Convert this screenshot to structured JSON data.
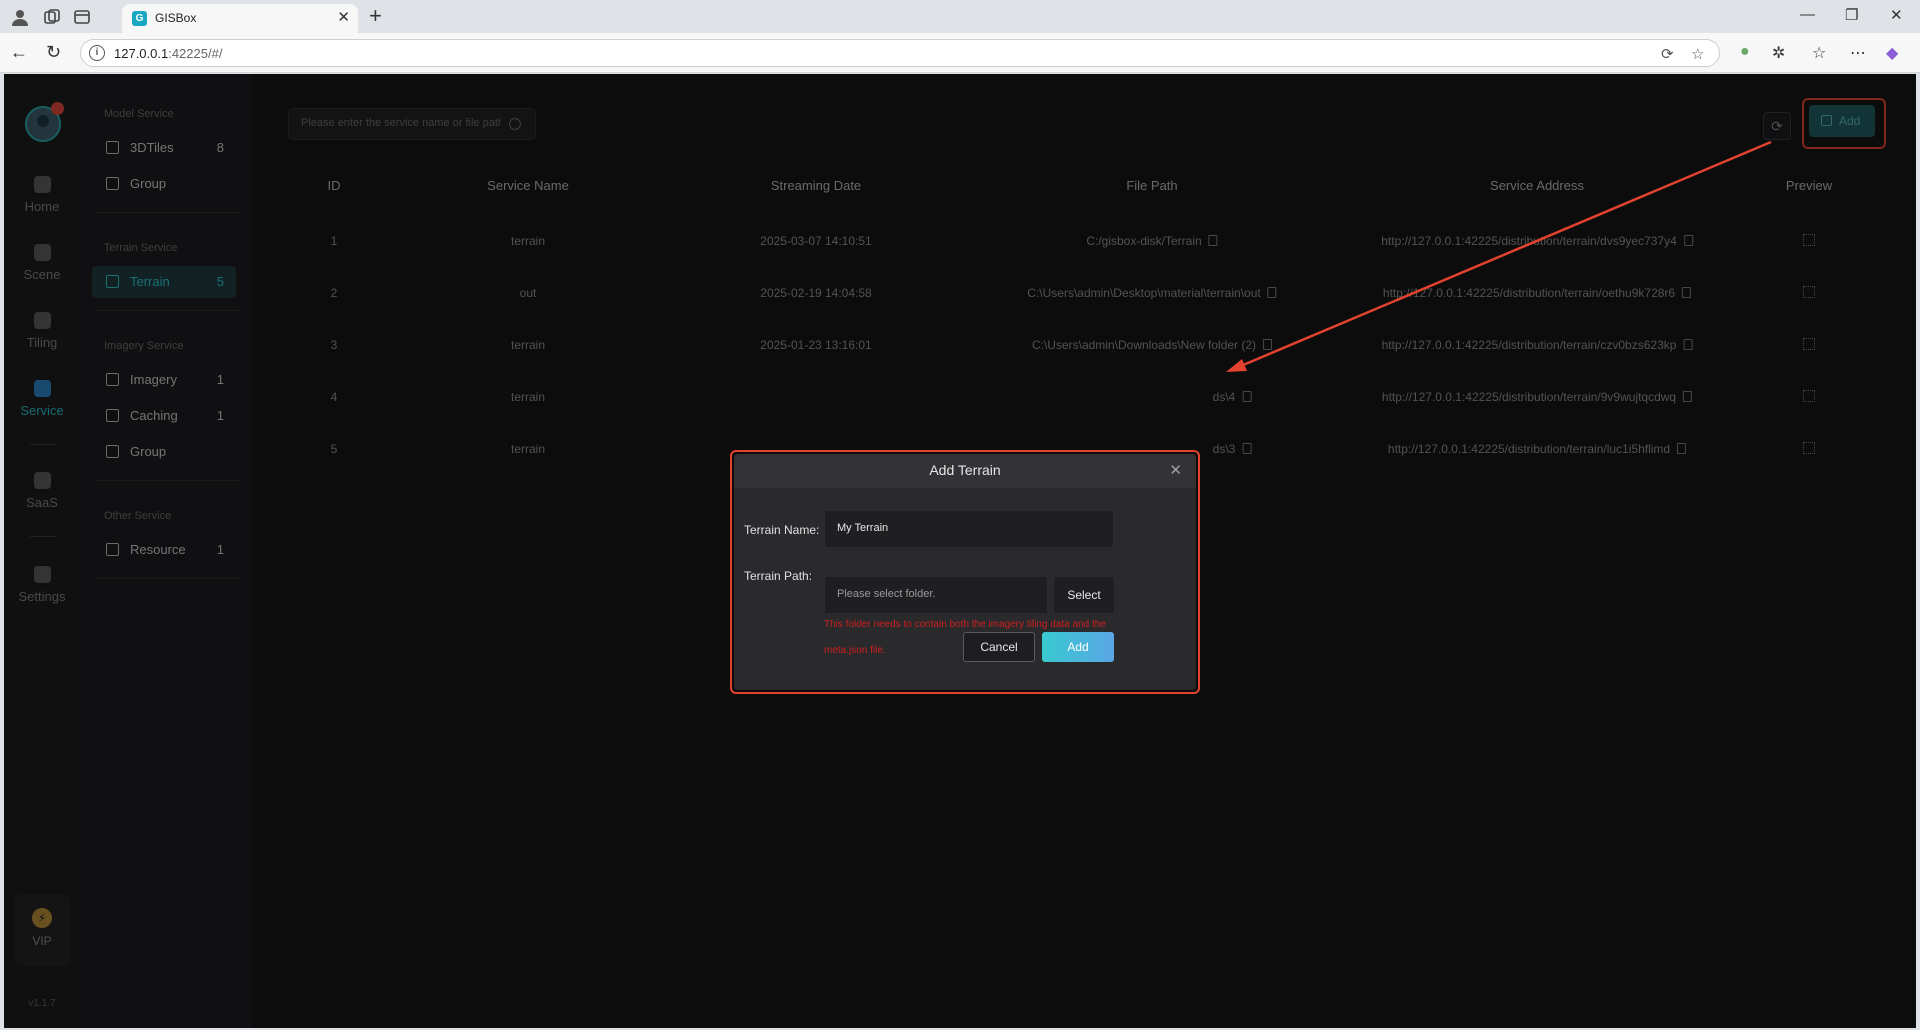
{
  "browser": {
    "tab_title": "GISBox",
    "tab_favicon": "G",
    "url_host": "127.0.0.1",
    "url_rest": ":42225/#/"
  },
  "rail": {
    "items": [
      {
        "label": "Home",
        "icon": "home-icon"
      },
      {
        "label": "Scene",
        "icon": "scene-icon"
      },
      {
        "label": "Tiling",
        "icon": "tiling-icon"
      },
      {
        "label": "Service",
        "icon": "service-icon"
      },
      {
        "label": "SaaS",
        "icon": "saas-icon"
      },
      {
        "label": "Settings",
        "icon": "settings-icon"
      }
    ],
    "vip_label": "VIP",
    "version": "v1.1.7"
  },
  "panel": {
    "model_title": "Model Service",
    "model_items": [
      {
        "label": "3DTiles",
        "count": "8"
      },
      {
        "label": "Group",
        "count": ""
      }
    ],
    "terrain_title": "Terrain Service",
    "terrain_items": [
      {
        "label": "Terrain",
        "count": "5"
      }
    ],
    "imagery_title": "Imagery Service",
    "imagery_items": [
      {
        "label": "Imagery",
        "count": "1"
      },
      {
        "label": "Caching",
        "count": "1"
      },
      {
        "label": "Group",
        "count": ""
      }
    ],
    "other_title": "Other Service",
    "other_items": [
      {
        "label": "Resource",
        "count": "1"
      }
    ]
  },
  "toolbar": {
    "search_placeholder": "Please enter the service name or file path.",
    "add_label": "Add"
  },
  "table": {
    "headers": [
      "ID",
      "Service Name",
      "Streaming Date",
      "File Path",
      "Service Address",
      "Preview"
    ],
    "rows": [
      {
        "id": "1",
        "name": "terrain",
        "date": "2025-03-07 14:10:51",
        "path": "C:/gisbox-disk/Terrain",
        "address": "http://127.0.0.1:42225/distribution/terrain/dvs9yec737y4"
      },
      {
        "id": "2",
        "name": "out",
        "date": "2025-02-19 14:04:58",
        "path": "C:\\Users\\admin\\Desktop\\material\\terrain\\out",
        "address": "http://127.0.0.1:42225/distribution/terrain/oethu9k728r6"
      },
      {
        "id": "3",
        "name": "terrain",
        "date": "2025-01-23 13:16:01",
        "path": "C:\\Users\\admin\\Downloads\\New folder (2)",
        "address": "http://127.0.0.1:42225/distribution/terrain/czv0bzs623kp"
      },
      {
        "id": "4",
        "name": "terrain",
        "date": "",
        "path": "ds\\4",
        "address": "http://127.0.0.1:42225/distribution/terrain/9v9wujtqcdwq"
      },
      {
        "id": "5",
        "name": "terrain",
        "date": "",
        "path": "ds\\3",
        "address": "http://127.0.0.1:42225/distribution/terrain/luc1i5hflimd"
      }
    ]
  },
  "modal": {
    "title": "Add Terrain",
    "name_label": "Terrain Name:",
    "name_value": "My Terrain",
    "path_label": "Terrain Path:",
    "path_placeholder": "Please select folder.",
    "select_label": "Select",
    "error_text": "This folder needs to contain both the imagery tiling data and the meta.json file.",
    "cancel_label": "Cancel",
    "add_label": "Add"
  },
  "colors": {
    "accent": "#2ec3c7",
    "highlight": "#e2432f",
    "error": "#cc1f1f",
    "background": "#161617"
  }
}
